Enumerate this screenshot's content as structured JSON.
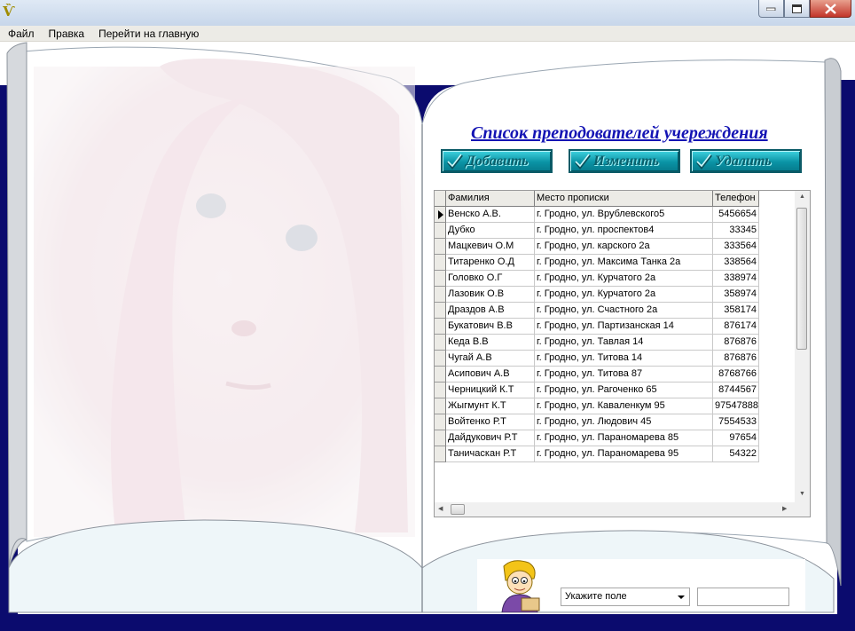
{
  "window": {
    "icon_glyph": "Ѷ"
  },
  "menu": [
    "Файл",
    "Правка",
    "Перейти на главную"
  ],
  "page": {
    "title": "Список преподователей учереждения",
    "buttons": [
      {
        "label": "Добавить",
        "icon": "checkmark-icon"
      },
      {
        "label": "Изменить",
        "icon": "checkmark-icon"
      },
      {
        "label": "Удалить",
        "icon": "checkmark-icon"
      }
    ]
  },
  "table": {
    "columns": [
      "Фамилия",
      "Место прописки",
      "Телефон"
    ],
    "rows": [
      [
        "Венско А.В.",
        "г. Гродно, ул. Врублевского5",
        "5456654"
      ],
      [
        "Дубко",
        "г. Гродно, ул. проспектов4",
        "33345"
      ],
      [
        "Мацкевич О.М",
        "г. Гродно, ул. карского 2а",
        "333564"
      ],
      [
        "Титаренко О.Д",
        "г. Гродно, ул. Максима Танка 2а",
        "338564"
      ],
      [
        "Головко  О.Г",
        "г. Гродно, ул. Курчатого 2а",
        "338974"
      ],
      [
        "Лазовик  О.В",
        "г. Гродно, ул. Курчатого 2а",
        "358974"
      ],
      [
        "Драздов  А.В",
        "г. Гродно, ул. Счастного 2а",
        "358174"
      ],
      [
        "Букатович  В.В",
        "г. Гродно, ул. Партизанская  14",
        "876174"
      ],
      [
        "Кеда  В.В",
        "г. Гродно, ул. Тавлая  14",
        "876876"
      ],
      [
        "Чугай А.В",
        "г. Гродно, ул. Титова  14",
        "876876"
      ],
      [
        "Асипович  А.В",
        "г. Гродно, ул. Титова  87",
        "8768766"
      ],
      [
        "Черницкий К.Т",
        "г. Гродно, ул. Рагоченко 65",
        "8744567"
      ],
      [
        "Жыгмунт  К.Т",
        "г. Гродно, ул. Каваленкум 95",
        "97547888"
      ],
      [
        "Войтенко   Р.Т",
        "г. Гродно, ул. Людович 45",
        "7554533"
      ],
      [
        "Дайдукович   Р.Т",
        "г. Гродно, ул. Параномарева 85",
        "97654"
      ],
      [
        "Таничаскан   Р.Т",
        "г. Гродно, ул. Параномарева 95",
        "54322"
      ]
    ],
    "selected_row": 0
  },
  "filter": {
    "field_select_value": "Укажите поле",
    "search_value": ""
  },
  "colors": {
    "book_border": "#0b0b6e",
    "button_teal": "#0a93a5",
    "title_blue": "#1414b4"
  }
}
